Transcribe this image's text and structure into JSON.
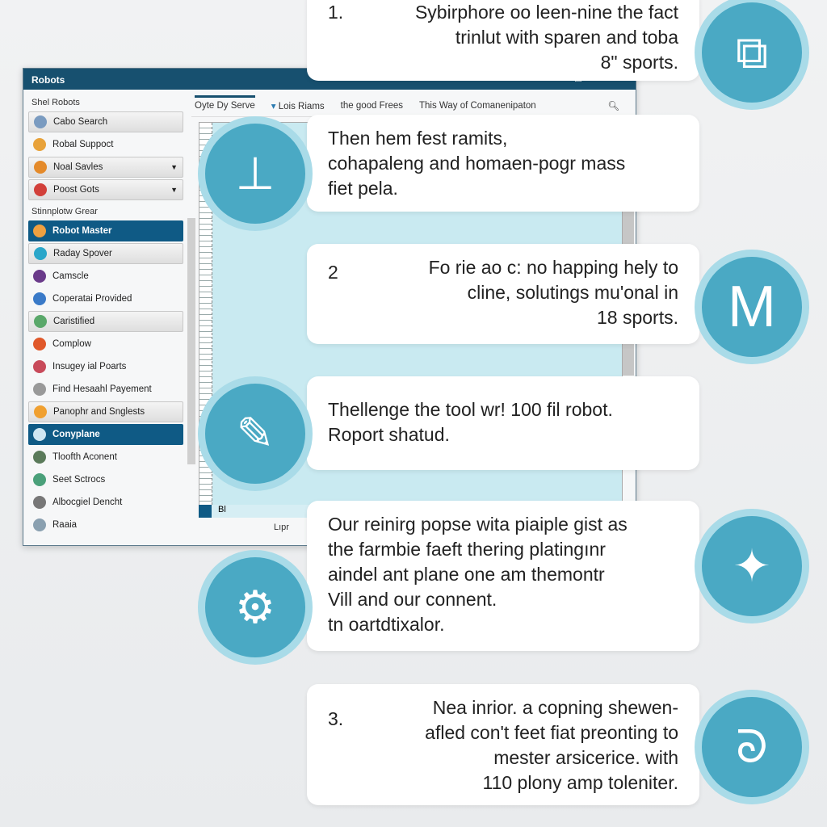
{
  "window": {
    "title": "Robots",
    "controls": [
      "–",
      "□",
      "×"
    ],
    "sidebar": {
      "section1": "Shel Robots",
      "section2": "Stinnplotw Grear",
      "items": [
        {
          "label": "Cabo Search",
          "style": "box",
          "color": "#7a9bc0"
        },
        {
          "label": "Robal Suppoct",
          "style": "plain",
          "color": "#e8a23a"
        },
        {
          "label": "Noal Savles",
          "style": "box",
          "color": "#e48a2a",
          "dropdown": true
        },
        {
          "label": "Poost Gots",
          "style": "box",
          "color": "#d2403a",
          "dropdown": true
        },
        {
          "label": "Robot Master",
          "style": "sel",
          "color": "#f0a040"
        },
        {
          "label": "Raday Spover",
          "style": "box",
          "color": "#2aa6c9"
        },
        {
          "label": "Camscle",
          "style": "plain",
          "color": "#6a3a8a"
        },
        {
          "label": "Coperatai Provided",
          "style": "plain",
          "color": "#3a7ac8"
        },
        {
          "label": "Caristified",
          "style": "box",
          "color": "#5aa86a"
        },
        {
          "label": "Complow",
          "style": "plain",
          "color": "#e0582a"
        },
        {
          "label": "Insugey ial Poarts",
          "style": "plain",
          "color": "#c84a5a"
        },
        {
          "label": "Find Hesaahl Payement",
          "style": "plain",
          "color": "#999999"
        },
        {
          "label": "Panophr and Snglests",
          "style": "box",
          "color": "#f0a030"
        },
        {
          "label": "Conyplane",
          "style": "sel",
          "color": "#cfe6f2"
        },
        {
          "label": "Tloofth Aconent",
          "style": "plain",
          "color": "#5a7a5a"
        },
        {
          "label": "Seet Sctrocs",
          "style": "plain",
          "color": "#4aa07a"
        },
        {
          "label": "Albocgiel Dencht",
          "style": "plain",
          "color": "#777777"
        },
        {
          "label": "Raaia",
          "style": "plain",
          "color": "#8aa0b0"
        }
      ]
    },
    "tabs": [
      "Oyte Dy Serve",
      "Lois Riams",
      "the good Frees",
      "This Way of Comanenipaton"
    ],
    "bottom_label": "Bl",
    "status": "Lıpr"
  },
  "cards": [
    {
      "num": "1.",
      "lines": [
        "Sybirphore oo leen-nine the fact",
        "trinlut with sparen and toba",
        "8\" sports."
      ],
      "align": "right"
    },
    {
      "num": "",
      "lines": [
        "Then hem fest ramits,",
        "cohapaleng and homaen-pogr mass",
        "fiet pela."
      ],
      "align": "left"
    },
    {
      "num": "2",
      "lines": [
        "Fo rie ao c: no happing hely to",
        "cline, solutings mu'onal in",
        "18 sports."
      ],
      "align": "right"
    },
    {
      "num": "",
      "lines": [
        "Thellenge the tool wr! 100 fil robot.",
        "Roport shatud."
      ],
      "align": "left"
    },
    {
      "num": "",
      "lines": [
        "Our reinirg popse wita piaiple gist as",
        "the farmbie faeft thering platingınr",
        "aindel ant plane one am themontr",
        "Vill and our connent.",
        "tn oartdtixalor."
      ],
      "align": "left"
    },
    {
      "num": "3.",
      "lines": [
        "Nea inrior. a copning shewen-",
        "afled con't feet fiat preonting to",
        "mester arsicerice. with",
        "110 plony amp toleniter."
      ],
      "align": "right"
    }
  ],
  "icons": [
    "puzzle-tools-icon",
    "drill-book-icon",
    "m-logo-icon",
    "tablet-pen-icon",
    "brush-icon",
    "pizza-cutter-icon",
    "wrench-hook-icon"
  ]
}
